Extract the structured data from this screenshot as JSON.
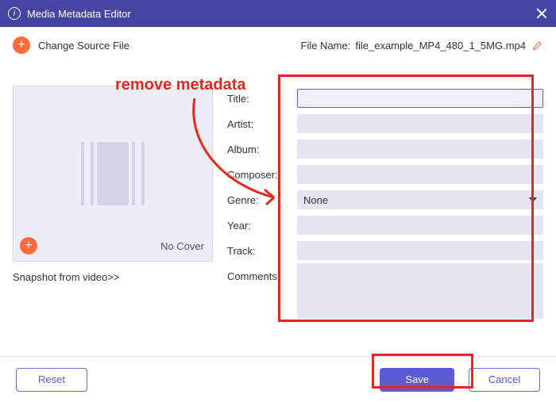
{
  "window": {
    "title": "Media Metadata Editor"
  },
  "header": {
    "change_source_label": "Change Source File",
    "file_name_label": "File Name:",
    "file_name_value": "file_example_MP4_480_1_5MG.mp4"
  },
  "annotation": {
    "text": "remove metadata"
  },
  "cover": {
    "no_cover_label": "No Cover",
    "snapshot_link": "Snapshot from video>>"
  },
  "fields": {
    "title": {
      "label": "Title:",
      "value": ""
    },
    "artist": {
      "label": "Artist:",
      "value": ""
    },
    "album": {
      "label": "Album:",
      "value": ""
    },
    "composer": {
      "label": "Composer:",
      "value": ""
    },
    "genre": {
      "label": "Genre:",
      "value": "None"
    },
    "year": {
      "label": "Year:",
      "value": ""
    },
    "track": {
      "label": "Track:",
      "value": ""
    },
    "comments": {
      "label": "Comments:",
      "value": ""
    }
  },
  "footer": {
    "reset": "Reset",
    "save": "Save",
    "cancel": "Cancel"
  }
}
